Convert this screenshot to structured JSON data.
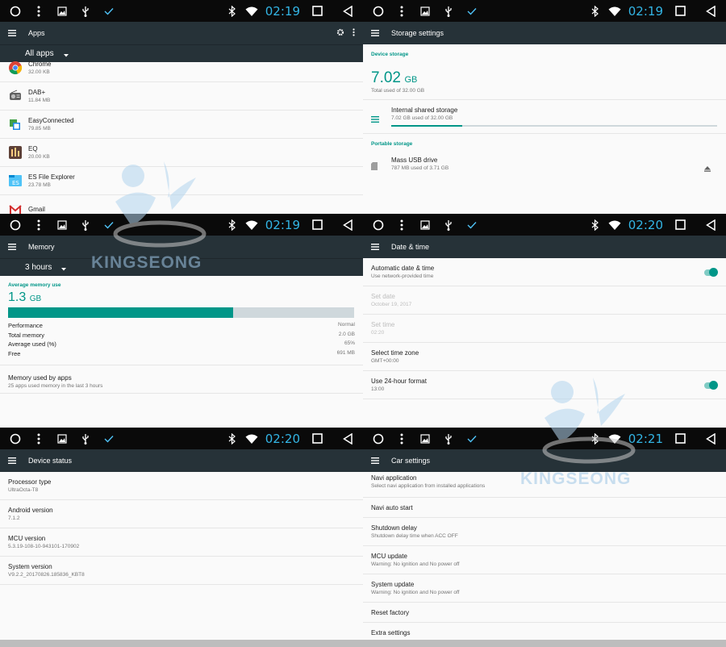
{
  "panels": {
    "apps": {
      "time": "02:19",
      "title": "Apps",
      "filter": "All apps",
      "items": [
        {
          "name": "Chrome",
          "size": "32.00 KB"
        },
        {
          "name": "DAB+",
          "size": "11.84 MB"
        },
        {
          "name": "EasyConnected",
          "size": "79.85 MB"
        },
        {
          "name": "EQ",
          "size": "20.00 KB"
        },
        {
          "name": "ES File Explorer",
          "size": "23.78 MB"
        },
        {
          "name": "Gmail",
          "size": ""
        }
      ]
    },
    "storage": {
      "time": "02:19",
      "title": "Storage settings",
      "device_section": "Device storage",
      "used_value": "7.02",
      "used_unit": "GB",
      "used_caption": "Total used of 32.00 GB",
      "internal_title": "Internal shared storage",
      "internal_sub": "7.02 GB used of 32.00 GB",
      "internal_fraction": 0.219,
      "portable_section": "Portable storage",
      "usb_title": "Mass USB drive",
      "usb_sub": "787 MB used of 3.71 GB"
    },
    "memory": {
      "time": "02:19",
      "title": "Memory",
      "filter": "3 hours",
      "section": "Average memory use",
      "avg_value": "1.3",
      "avg_unit": "GB",
      "usage_fraction": 0.65,
      "stats": [
        {
          "label": "Performance",
          "value": "Normal"
        },
        {
          "label": "Total memory",
          "value": "2.0 GB"
        },
        {
          "label": "Average used (%)",
          "value": "65%"
        },
        {
          "label": "Free",
          "value": "691 MB"
        }
      ],
      "apps_title": "Memory used by apps",
      "apps_sub": "25 apps used memory in the last 3 hours"
    },
    "datetime": {
      "time": "02:20",
      "title": "Date & time",
      "items": [
        {
          "title": "Automatic date & time",
          "sub": "Use network-provided time",
          "toggle": true,
          "dim": false
        },
        {
          "title": "Set date",
          "sub": "October 19, 2017",
          "toggle": false,
          "dim": true
        },
        {
          "title": "Set time",
          "sub": "02:20",
          "toggle": false,
          "dim": true
        },
        {
          "title": "Select time zone",
          "sub": "GMT+00:00",
          "toggle": false,
          "dim": false
        },
        {
          "title": "Use 24-hour format",
          "sub": "13:00",
          "toggle": true,
          "dim": false
        }
      ]
    },
    "device": {
      "time": "02:20",
      "title": "Device status",
      "items": [
        {
          "title": "Processor type",
          "sub": "UltraOcta-T8"
        },
        {
          "title": "Android version",
          "sub": "7.1.2"
        },
        {
          "title": "MCU version",
          "sub": "5.3.19-108-10-943101-170902"
        },
        {
          "title": "System version",
          "sub": "V9.2.2_20170826.185836_KBT8"
        }
      ]
    },
    "car": {
      "time": "02:21",
      "title": "Car settings",
      "items": [
        {
          "title": "Navi application",
          "sub": "Select navi application from installed applications"
        },
        {
          "title": "Navi auto start",
          "sub": ""
        },
        {
          "title": "Shutdown delay",
          "sub": "Shutdown delay time when ACC OFF"
        },
        {
          "title": "MCU update",
          "sub": "Warning: No ignition and No power off"
        },
        {
          "title": "System update",
          "sub": "Warning: No ignition and No power off"
        },
        {
          "title": "Reset factory",
          "sub": ""
        },
        {
          "title": "Extra settings",
          "sub": ""
        }
      ]
    }
  },
  "watermark": {
    "text": "KINGSEONG"
  },
  "colors": {
    "accent": "#009688",
    "clock": "#33b5e5",
    "appbar": "#263238",
    "statusbar": "#0a0a0a"
  },
  "icons": [
    "home-circle-icon",
    "more-vert-icon",
    "image-icon",
    "usb-icon",
    "check-icon",
    "bluetooth-icon",
    "wifi-icon",
    "recents-square-icon",
    "back-triangle-icon",
    "menu-icon",
    "gear-icon"
  ]
}
